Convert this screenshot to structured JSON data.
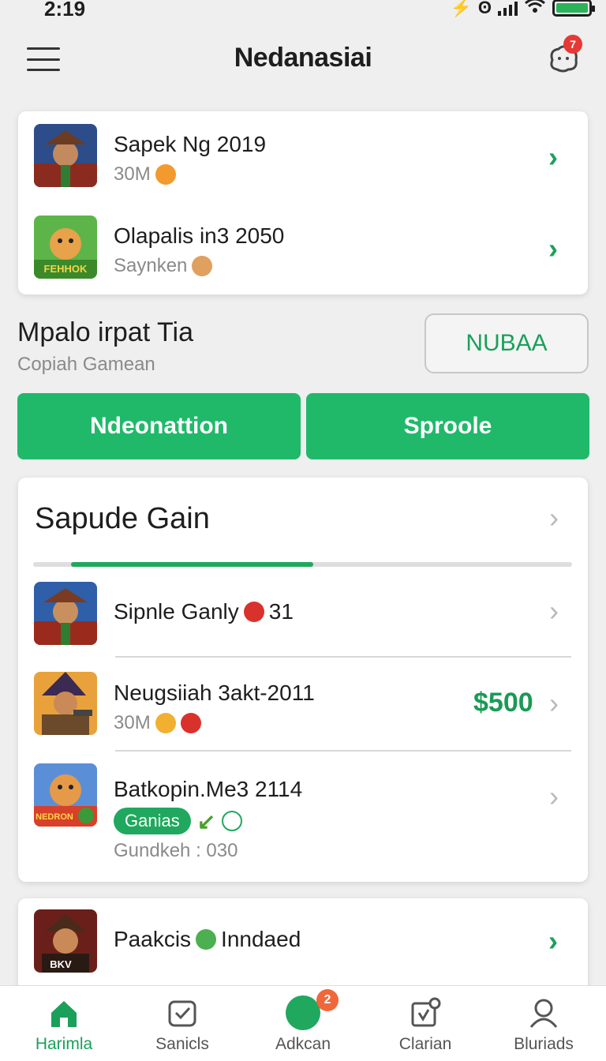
{
  "status_bar": {
    "time": "2:19",
    "extra": "⚡"
  },
  "header": {
    "title": "Nedanasiai",
    "notif_count": "7"
  },
  "top_list": [
    {
      "title": "Sapek Ng 2019",
      "subtitle": "30M"
    },
    {
      "title": "Olapalis in3 2050",
      "subtitle": "Saynken",
      "thumb_text": "FEHHOK"
    }
  ],
  "section": {
    "heading": "Mpalo irpat Tia",
    "subheading": "Copiah Gamean",
    "outline_button": "NUBAA"
  },
  "actions": {
    "left_button": "Ndeonattion",
    "right_button": "Sproole"
  },
  "games_card": {
    "title": "Sapude Gain",
    "progress": 0.45,
    "rows": [
      {
        "title": "Sipnle Ganly",
        "title_suffix": "31"
      },
      {
        "title": "Neugsiiah 3akt-2011",
        "subtitle": "30M",
        "price": "$500"
      },
      {
        "title": "Batkopin.Me3 2114",
        "pill": "Ganias",
        "meta": "Gundkeh : 030",
        "thumb_text": "NEDRON"
      }
    ]
  },
  "bottom_card": {
    "title": "Paakcis",
    "title_suffix": "Inndaed",
    "thumb_text": "BKV"
  },
  "bottom_nav": [
    {
      "label": "Harimla",
      "icon": "home-icon",
      "active": true
    },
    {
      "label": "Sanicls",
      "icon": "check-box-icon"
    },
    {
      "label": "Adkcan",
      "icon": "circle-icon",
      "badge": "2"
    },
    {
      "label": "Clarian",
      "icon": "calendar-check-icon"
    },
    {
      "label": "Bluriads",
      "icon": "user-icon"
    }
  ],
  "colors": {
    "accent": "#20b96a",
    "price": "#1a9a55",
    "badge": "#f0673b",
    "notif": "#e53935"
  }
}
